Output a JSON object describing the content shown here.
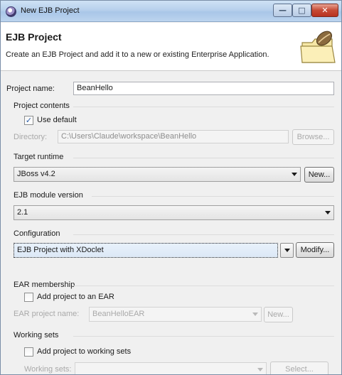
{
  "window": {
    "title": "New EJB Project"
  },
  "banner": {
    "title": "EJB Project",
    "description": "Create an EJB Project and add it to a new or existing Enterprise Application."
  },
  "project_name": {
    "label": "Project name:",
    "value": "BeanHello"
  },
  "project_contents": {
    "heading": "Project contents",
    "use_default_label": "Use default",
    "use_default_checked": true,
    "directory_label": "Directory:",
    "directory_value": "C:\\Users\\Claude\\workspace\\BeanHello",
    "browse_label": "Browse..."
  },
  "target_runtime": {
    "heading": "Target runtime",
    "value": "JBoss v4.2",
    "new_label": "New..."
  },
  "ejb_module_version": {
    "heading": "EJB module version",
    "value": "2.1"
  },
  "configuration": {
    "heading": "Configuration",
    "value": "EJB Project with XDoclet",
    "modify_label": "Modify..."
  },
  "ear_membership": {
    "heading": "EAR membership",
    "add_label": "Add project to an EAR",
    "add_checked": false,
    "ear_name_label": "EAR project name:",
    "ear_name_value": "BeanHelloEAR",
    "new_label": "New..."
  },
  "working_sets": {
    "heading": "Working sets",
    "add_label": "Add project to working sets",
    "add_checked": false,
    "working_sets_label": "Working sets:",
    "select_label": "Select..."
  }
}
